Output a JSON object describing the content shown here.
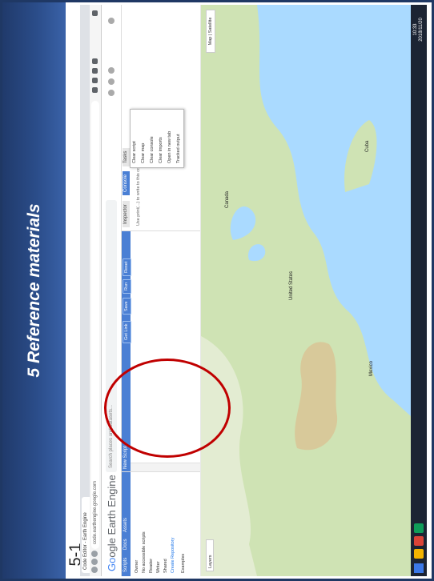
{
  "slide": {
    "title": "5 Reference materials",
    "slide_label": "5-1",
    "page_number": "35",
    "accent_color": "#203a6b",
    "highlight_color": "#c00000"
  },
  "browser": {
    "tab_title": "Code Editor - Earth Engine",
    "url": "code.earthengine.google.com"
  },
  "gee": {
    "logo_g": "Go",
    "logo_rest": "ogle Earth Engine",
    "search_placeholder": "Search places and datasets...",
    "left_tabs": [
      "Scripts",
      "Docs",
      "Assets"
    ],
    "left_lines": [
      "Owner",
      "No accessible scripts",
      "Reader",
      "Writer",
      "Shared",
      "Examples"
    ],
    "left_link": "Create Repository",
    "editor_title": "New Script",
    "editor_buttons": [
      "Get Link",
      "Save",
      "Run",
      "Reset"
    ],
    "right_tabs": [
      "Inspector",
      "Console",
      "Tasks"
    ],
    "console_hint": "Use print(...) to write to this console.",
    "dropdown_items": [
      "Clear script",
      "Clear map",
      "Clear console",
      "Clear imports",
      "Open in new tab",
      "Tracked output"
    ]
  },
  "map": {
    "map_type_buttons": [
      "Map",
      "Satellite"
    ],
    "tools_label": "Layers",
    "labels": [
      "United States",
      "Mexico",
      "Canada",
      "Cuba"
    ]
  },
  "taskbar": {
    "clock_time": "10:33",
    "clock_date": "2018/11/20"
  }
}
